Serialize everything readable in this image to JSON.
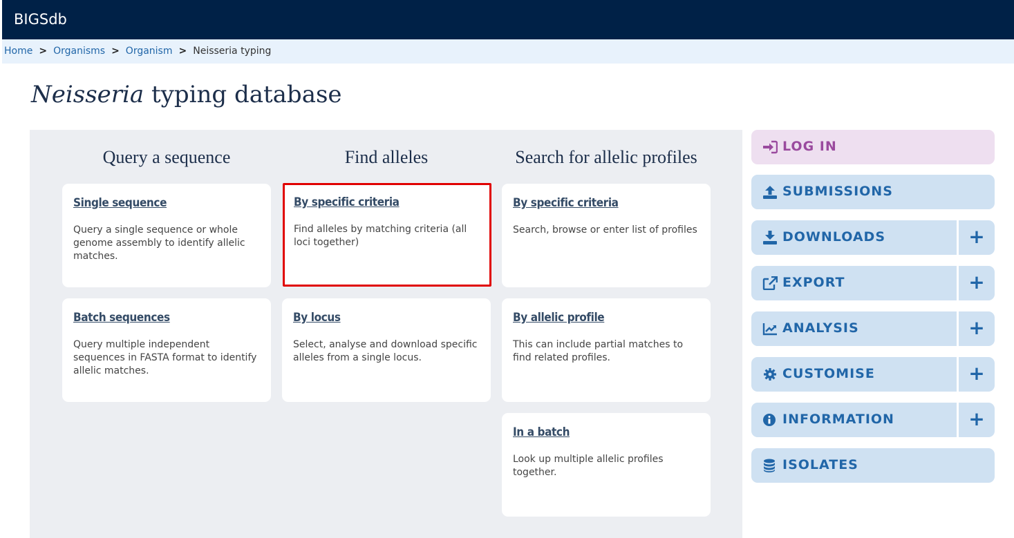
{
  "header": {
    "brand": "BIGSdb"
  },
  "breadcrumb": {
    "home": "Home",
    "organisms": "Organisms",
    "organism": "Organism",
    "current": "Neisseria typing",
    "separator": ">"
  },
  "page": {
    "title_italic": "Neisseria",
    "title_rest": " typing database"
  },
  "columns": {
    "query": {
      "heading": "Query a sequence"
    },
    "alleles": {
      "heading": "Find alleles"
    },
    "profiles": {
      "heading": "Search for allelic profiles"
    }
  },
  "cards": {
    "single": {
      "title": "Single sequence",
      "desc": "Query a single sequence or whole genome assembly to identify allelic matches."
    },
    "batch": {
      "title": "Batch sequences",
      "desc": "Query multiple independent sequences in FASTA format to identify allelic matches."
    },
    "alleles_criteria": {
      "title": "By specific criteria",
      "desc": "Find alleles by matching criteria (all loci together)"
    },
    "alleles_locus": {
      "title": "By locus",
      "desc": "Select, analyse and download specific alleles from a single locus."
    },
    "profiles_criteria": {
      "title": "By specific criteria",
      "desc": "Search, browse or enter list of profiles"
    },
    "profiles_allelic": {
      "title": "By allelic profile",
      "desc": "This can include partial matches to find related profiles."
    },
    "profiles_batch": {
      "title": "In a batch",
      "desc": "Look up multiple allelic profiles together."
    }
  },
  "sidebar": {
    "login": "LOG IN",
    "submissions": "SUBMISSIONS",
    "downloads": "DOWNLOADS",
    "export": "EXPORT",
    "analysis": "ANALYSIS",
    "customise": "CUSTOMISE",
    "information": "INFORMATION",
    "isolates": "ISOLATES",
    "expand_symbol": "+"
  },
  "colors": {
    "header_bg": "#002147",
    "link": "#2166a8",
    "login_bg": "#eedff0",
    "login_text": "#9a4a9e",
    "side_bg": "#cfe1f2",
    "highlight": "#e00000"
  }
}
